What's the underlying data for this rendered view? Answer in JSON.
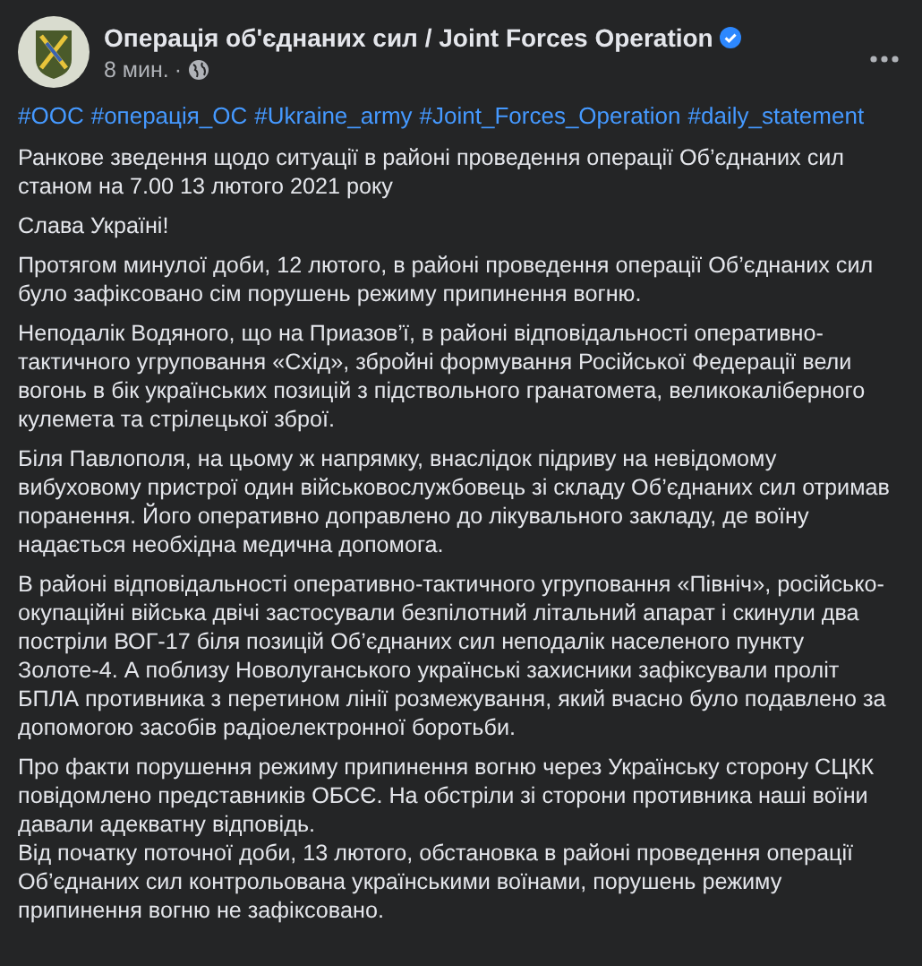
{
  "post": {
    "author": "Операція об'єднаних сил / Joint Forces Operation",
    "verified": true,
    "time": "8 мин.",
    "separator": "·",
    "hashtags": [
      "#ООС",
      "#операція_ОС",
      "#Ukraine_army",
      "#Joint_Forces_Operation",
      "#daily_statement"
    ],
    "paragraphs": [
      "Ранкове зведення щодо ситуації в районі проведення операції Об’єднаних сил станом на 7.00 13 лютого 2021 року",
      "Слава Україні!",
      "Протягом минулої доби, 12 лютого, в районі проведення операції Об’єднаних сил було зафіксовано сім порушень режиму припинення вогню.",
      "Неподалік Водяного, що на Приазов’ї, в районі відповідальності оперативно-тактичного угруповання «Схід», збройні формування Російської Федерації вели вогонь в бік українських позицій з підствольного гранатомета, великокаліберного кулемета та стрілецької зброї.",
      "Біля Павлополя, на цьому ж напрямку, внаслідок підриву на невідомому вибуховому пристрої один військовослужбовець зі складу Об’єднаних сил отримав поранення. Його оперативно доправлено до лікувального закладу, де воїну надається необхідна медична допомога.",
      "В районі відповідальності оперативно-тактичного угруповання «Північ», російсько-окупаційні війська двічі застосували безпілотний літальний апарат і скинули два постріли ВОГ-17 біля позицій Об’єднаних сил неподалік населеного пункту Золоте-4. А поблизу Новолуганського українські захисники зафіксували проліт БПЛА противника з перетином лінії розмежування, який вчасно було подавлено за допомогою засобів радіоелектронної боротьби.",
      "Про факти порушення режиму припинення вогню через Українську сторону СЦКК повідомлено представників ОБСЄ. На обстріли зі сторони противника наші воїни давали адекватну відповідь.\nВід початку поточної доби, 13 лютого, обстановка в районі проведення операції Об’єднаних сил контрольована українськими воїнами, порушень режиму припинення вогню не зафіксовано."
    ]
  }
}
